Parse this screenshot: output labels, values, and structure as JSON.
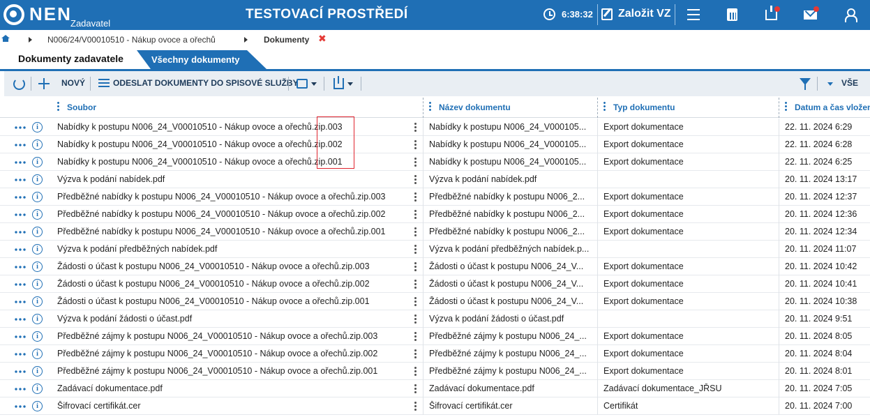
{
  "app": {
    "logo": "NEN",
    "logo_sub": "Zadavatel",
    "environment_title": "TESTOVACÍ PROSTŘEDÍ",
    "timer": "6:38:32",
    "create_label": "Založit VZ",
    "brand_color": "#1f6fb5",
    "alert_color": "#e53935"
  },
  "breadcrumb": {
    "items": [
      "N006/24/V00010510 - Nákup ovoce a ořechů",
      "Dokumenty"
    ],
    "close_label": "✖"
  },
  "tabs": {
    "active": "Dokumenty zadavatele",
    "inactive": "Všechny dokumenty"
  },
  "toolbar": {
    "new_label": "NOVÝ",
    "send_label": "ODESLAT DOKUMENTY DO SPISOVÉ SLUŽBY",
    "filter_label": "VŠE"
  },
  "grid": {
    "columns": [
      "Soubor",
      "Název dokumentu",
      "Typ dokumentu",
      "Datum a čas vložení"
    ],
    "rows": [
      {
        "file": "Nabídky k postupu N006_24_V00010510 - Nákup ovoce a ořechů.zip.003",
        "name": "Nabídky k postupu N006_24_V000105...",
        "type": "Export dokumentace",
        "date": "22. 11. 2024 6:29"
      },
      {
        "file": "Nabídky k postupu N006_24_V00010510 - Nákup ovoce a ořechů.zip.002",
        "name": "Nabídky k postupu N006_24_V000105...",
        "type": "Export dokumentace",
        "date": "22. 11. 2024 6:28"
      },
      {
        "file": "Nabídky k postupu N006_24_V00010510 - Nákup ovoce a ořechů.zip.001",
        "name": "Nabídky k postupu N006_24_V000105...",
        "type": "Export dokumentace",
        "date": "22. 11. 2024 6:25"
      },
      {
        "file": "Výzva k podání nabídek.pdf",
        "name": "Výzva k podání nabídek.pdf",
        "type": "",
        "date": "20. 11. 2024 13:17"
      },
      {
        "file": "Předběžné nabídky k postupu N006_24_V00010510 - Nákup ovoce a ořechů.zip.003",
        "name": "Předběžné nabídky k postupu N006_2...",
        "type": "Export dokumentace",
        "date": "20. 11. 2024 12:37"
      },
      {
        "file": "Předběžné nabídky k postupu N006_24_V00010510 - Nákup ovoce a ořechů.zip.002",
        "name": "Předběžné nabídky k postupu N006_2...",
        "type": "Export dokumentace",
        "date": "20. 11. 2024 12:36"
      },
      {
        "file": "Předběžné nabídky k postupu N006_24_V00010510 - Nákup ovoce a ořechů.zip.001",
        "name": "Předběžné nabídky k postupu N006_2...",
        "type": "Export dokumentace",
        "date": "20. 11. 2024 12:34"
      },
      {
        "file": "Výzva k podání předběžných nabídek.pdf",
        "name": "Výzva k podání předběžných nabídek.p...",
        "type": "",
        "date": "20. 11. 2024 11:07"
      },
      {
        "file": "Žádosti o účast k postupu N006_24_V00010510 - Nákup ovoce a ořechů.zip.003",
        "name": "Žádosti o účast k postupu N006_24_V...",
        "type": "Export dokumentace",
        "date": "20. 11. 2024 10:42"
      },
      {
        "file": "Žádosti o účast k postupu N006_24_V00010510 - Nákup ovoce a ořechů.zip.002",
        "name": "Žádosti o účast k postupu N006_24_V...",
        "type": "Export dokumentace",
        "date": "20. 11. 2024 10:41"
      },
      {
        "file": "Žádosti o účast k postupu N006_24_V00010510 - Nákup ovoce a ořechů.zip.001",
        "name": "Žádosti o účast k postupu N006_24_V...",
        "type": "Export dokumentace",
        "date": "20. 11. 2024 10:38"
      },
      {
        "file": "Výzva k podání žádosti o účast.pdf",
        "name": "Výzva k podání žádosti o účast.pdf",
        "type": "",
        "date": "20. 11. 2024 9:51"
      },
      {
        "file": "Předběžné zájmy k postupu N006_24_V00010510 - Nákup ovoce a ořechů.zip.003",
        "name": "Předběžné zájmy k postupu N006_24_...",
        "type": "Export dokumentace",
        "date": "20. 11. 2024 8:05"
      },
      {
        "file": "Předběžné zájmy k postupu N006_24_V00010510 - Nákup ovoce a ořechů.zip.002",
        "name": "Předběžné zájmy k postupu N006_24_...",
        "type": "Export dokumentace",
        "date": "20. 11. 2024 8:04"
      },
      {
        "file": "Předběžné zájmy k postupu N006_24_V00010510 - Nákup ovoce a ořechů.zip.001",
        "name": "Předběžné zájmy k postupu N006_24_...",
        "type": "Export dokumentace",
        "date": "20. 11. 2024 8:01"
      },
      {
        "file": "Zadávací dokumentace.pdf",
        "name": "Zadávací dokumentace.pdf",
        "type": "Zadávací dokumentace_JŘSU",
        "date": "20. 11. 2024 7:05"
      },
      {
        "file": "Šifrovací certifikát.cer",
        "name": "Šifrovací certifikát.cer",
        "type": "Certifikát",
        "date": "20. 11. 2024 7:00"
      }
    ]
  },
  "icons": {
    "header": [
      "timer-icon",
      "create-icon",
      "menu-icon",
      "calculator-icon",
      "inbox-icon",
      "mail-icon",
      "user-icon"
    ],
    "toolbar": [
      "refresh-icon",
      "plus-icon",
      "send-icon",
      "print-icon",
      "export-icon",
      "filter-icon"
    ],
    "row": [
      "more-icon",
      "info-icon",
      "kebab-icon"
    ]
  }
}
